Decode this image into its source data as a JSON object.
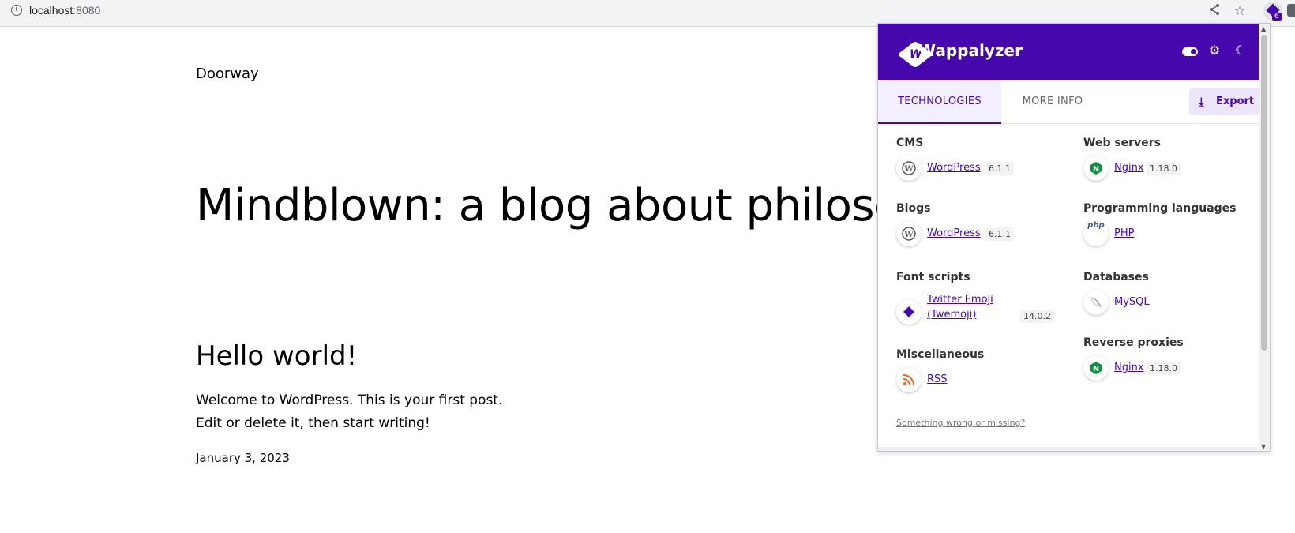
{
  "browser": {
    "url_host": "localhost",
    "url_port": ":8080",
    "icons": [
      "info-icon",
      "share-icon",
      "star-icon",
      "wappalyzer-extension-icon",
      "extensions-icon"
    ],
    "extension_badge": "6"
  },
  "page": {
    "site_title": "Doorway",
    "hero_title": "Mindblown: a blog about philoso",
    "post": {
      "title": "Hello world!",
      "line1": "Welcome to WordPress. This is your first post.",
      "line2": "Edit or delete it, then start writing!",
      "date": "January 3, 2023"
    }
  },
  "wappalyzer": {
    "brand_name": "Wappalyzer",
    "brand_color": "#4608ad",
    "header_icons": [
      "toggle-icon",
      "gear-icon",
      "moon-icon"
    ],
    "tabs": {
      "technologies": "TECHNOLOGIES",
      "more_info": "MORE INFO"
    },
    "export_label": "Export",
    "categories": {
      "cms": {
        "title": "CMS",
        "name": "WordPress",
        "version": "6.1.1",
        "icon": "wordpress-icon"
      },
      "blogs": {
        "title": "Blogs",
        "name": "WordPress",
        "version": "6.1.1",
        "icon": "wordpress-icon"
      },
      "font_scripts": {
        "title": "Font scripts",
        "name_line1": "Twitter Emoji",
        "name_line2": "(Twemoji)",
        "version": "14.0.2",
        "icon": "twemoji-icon"
      },
      "misc": {
        "title": "Miscellaneous",
        "name": "RSS",
        "icon": "rss-icon"
      },
      "web_servers": {
        "title": "Web servers",
        "name": "Nginx",
        "version": "1.18.0",
        "icon": "nginx-icon"
      },
      "prog_langs": {
        "title": "Programming languages",
        "name": "PHP",
        "icon": "php-icon"
      },
      "databases": {
        "title": "Databases",
        "name": "MySQL",
        "icon": "mysql-icon"
      },
      "reverse_proxies": {
        "title": "Reverse proxies",
        "name": "Nginx",
        "version": "1.18.0",
        "icon": "nginx-icon"
      }
    },
    "footer_link": "Something wrong or missing?"
  }
}
